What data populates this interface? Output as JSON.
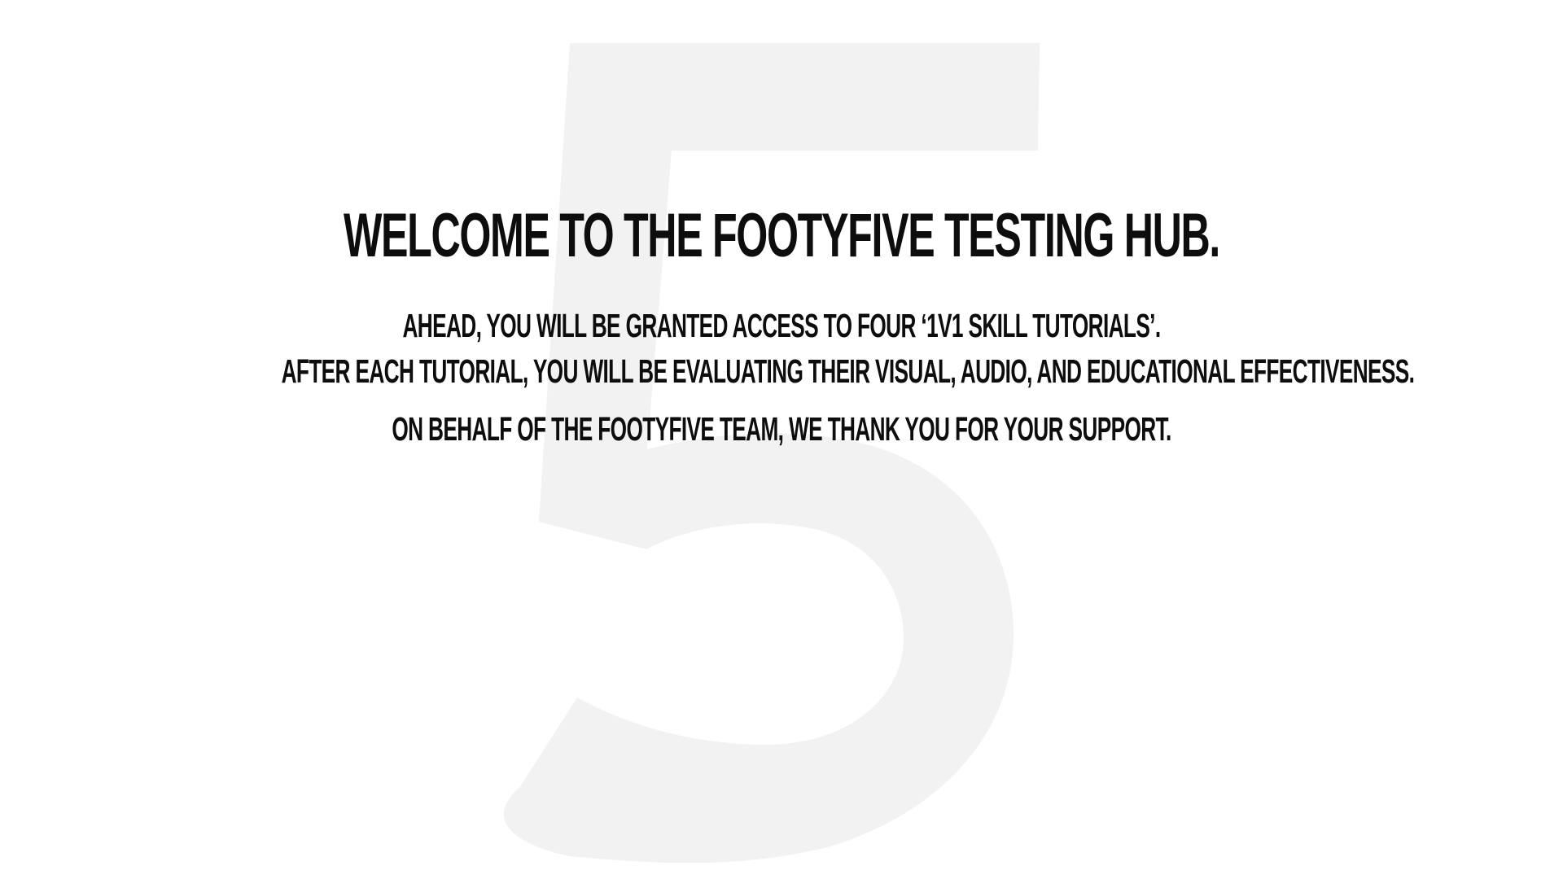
{
  "welcome": {
    "headline": "Welcome to the FootyFive Testing Hub.",
    "line_1": "Ahead, you will be granted access to four ‘1v1 skill tutorials’.",
    "line_2": "After each tutorial, you will be evaluating their visual, audio, and educational effectiveness.",
    "line_3": "On behalf of the FootyFive team, we thank you for your support."
  },
  "background": {
    "glyph": "5",
    "glyph_color": "#f2f2f2",
    "page_color": "#ffffff",
    "text_color": "#0d0d0d"
  }
}
